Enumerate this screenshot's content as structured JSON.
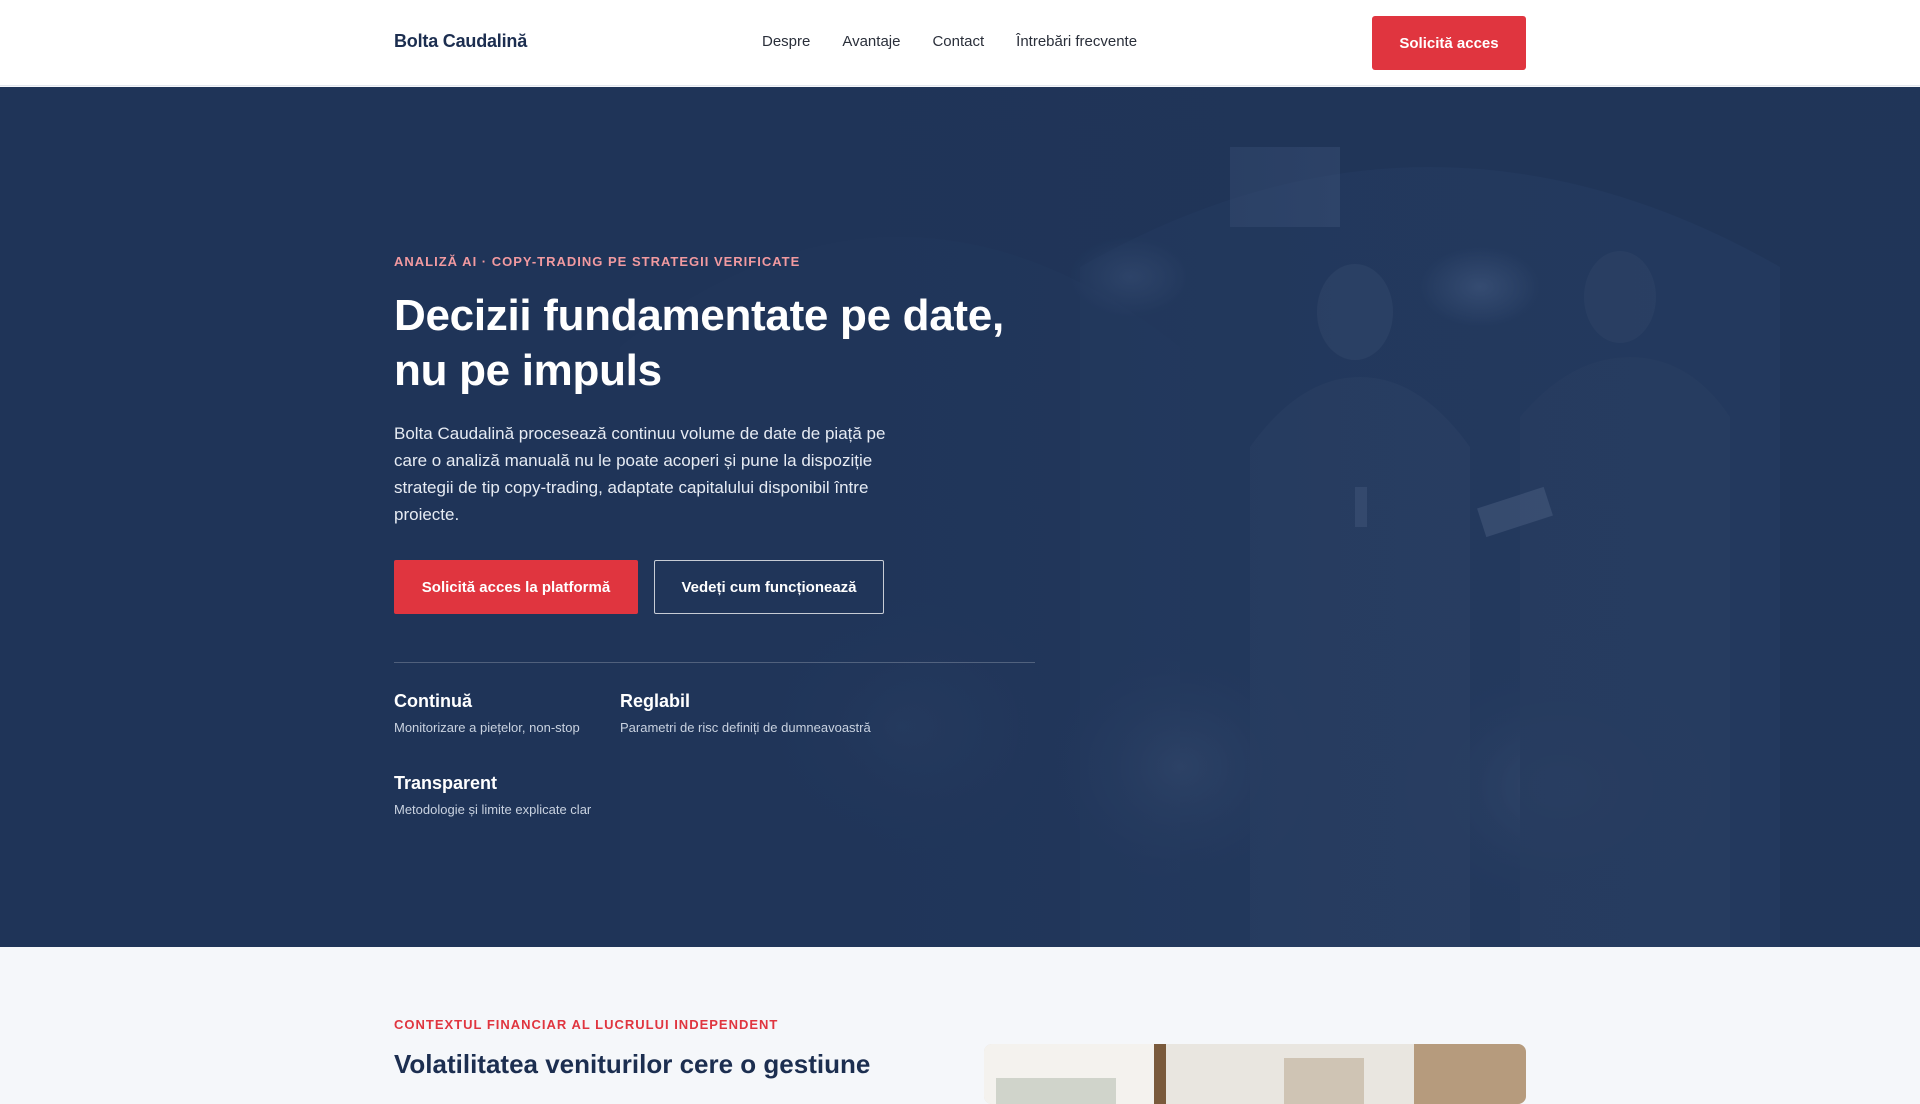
{
  "header": {
    "logo": "Bolta Caudalină",
    "nav": [
      "Despre",
      "Avantaje",
      "Contact",
      "Întrebări frecvente"
    ],
    "cta": "Solicită acces"
  },
  "hero": {
    "eyebrow": "ANALIZĂ AI · COPY-TRADING PE STRATEGII VERIFICATE",
    "title_line1": "Decizii fundamentate pe date,",
    "title_line2": "nu pe impuls",
    "description": "Bolta Caudalină procesează continuu volume de date de piață pe care o analiză manuală nu le poate acoperi și pune la dispoziție strategii de tip copy-trading, adaptate capitalului disponibil între proiecte.",
    "primary_button": "Solicită acces la platformă",
    "secondary_button": "Vedeți cum funcționează",
    "features": [
      {
        "title": "Continuă",
        "text": "Monitorizare a piețelor, non-stop"
      },
      {
        "title": "Reglabil",
        "text": "Parametri de risc definiți de dumneavoastră"
      },
      {
        "title": "Transparent",
        "text": "Metodologie și limite explicate clar"
      }
    ]
  },
  "section": {
    "eyebrow": "CONTEXTUL FINANCIAR AL LUCRULUI INDEPENDENT",
    "title": "Volatilitatea veniturilor cere o gestiune"
  },
  "colors": {
    "accent": "#e0353f",
    "navy": "#1f3458",
    "eyebrow_pink": "#f29aa0"
  }
}
